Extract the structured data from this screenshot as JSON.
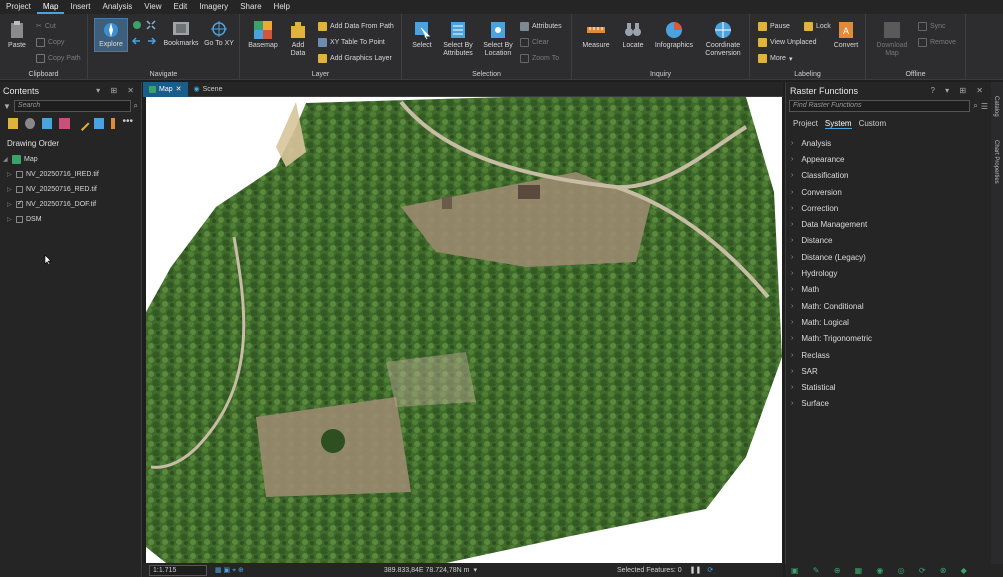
{
  "menu": {
    "items": [
      "Project",
      "Map",
      "Insert",
      "Analysis",
      "View",
      "Edit",
      "Imagery",
      "Share",
      "Help"
    ],
    "active": "Map"
  },
  "ribbon": {
    "clipboard": {
      "label": "Clipboard",
      "paste": "Paste",
      "cut": "Cut",
      "copy": "Copy",
      "copy_path": "Copy Path"
    },
    "navigate": {
      "label": "Navigate",
      "explore": "Explore",
      "bookmarks": "Bookmarks",
      "go_to_xy": "Go To XY"
    },
    "layer": {
      "label": "Layer",
      "basemap": "Basemap",
      "add_data": "Add Data",
      "add_data_from_path": "Add Data From Path",
      "xy_table_to_point": "XY Table To Point",
      "add_graphics_layer": "Add Graphics Layer"
    },
    "selection": {
      "label": "Selection",
      "select": "Select",
      "select_by_attributes": "Select By Attributes",
      "select_by_location": "Select By Location",
      "attributes": "Attributes",
      "clear": "Clear",
      "zoom_to": "Zoom To"
    },
    "inquiry": {
      "label": "Inquiry",
      "measure": "Measure",
      "locate": "Locate",
      "infographics": "Infographics",
      "coordinate_conversion": "Coordinate Conversion"
    },
    "labeling": {
      "label": "Labeling",
      "pause": "Pause",
      "lock": "Lock",
      "view_unplaced": "View Unplaced",
      "more": "More",
      "convert": "Convert"
    },
    "offline": {
      "label": "Offline",
      "download_map": "Download Map",
      "sync": "Sync",
      "remove": "Remove"
    }
  },
  "contents": {
    "title": "Contents",
    "search_placeholder": "Search",
    "drawing_order": "Drawing Order",
    "map_name": "Map",
    "layers": [
      {
        "name": "NV_20250716_IRED.tif",
        "checked": false
      },
      {
        "name": "NV_20250716_RED.tif",
        "checked": false
      },
      {
        "name": "NV_20250716_DOF.tif",
        "checked": true
      },
      {
        "name": "DSM",
        "checked": false
      }
    ]
  },
  "tabs": {
    "map": "Map",
    "scene": "Scene"
  },
  "status": {
    "scale": "1:1.715",
    "coordinates": "389.833,84E 78.724,78N m",
    "selected_features": "Selected Features: 0"
  },
  "raster_functions": {
    "title": "Raster Functions",
    "search_placeholder": "Find Raster Functions",
    "tabs": [
      "Project",
      "System",
      "Custom"
    ],
    "active_tab": "System",
    "categories": [
      "Analysis",
      "Appearance",
      "Classification",
      "Conversion",
      "Correction",
      "Data Management",
      "Distance",
      "Distance (Legacy)",
      "Hydrology",
      "Math",
      "Math: Conditional",
      "Math: Logical",
      "Math: Trigonometric",
      "Reclass",
      "SAR",
      "Statistical",
      "Surface"
    ]
  },
  "side_strip": {
    "catalog": "Catalog",
    "chart_properties": "Chart Properties"
  },
  "colors": {
    "accent": "#4aa3df",
    "map_tab": "#1a5c8a",
    "forest": "#3f6a2c",
    "clearing": "#9a8b6f"
  }
}
